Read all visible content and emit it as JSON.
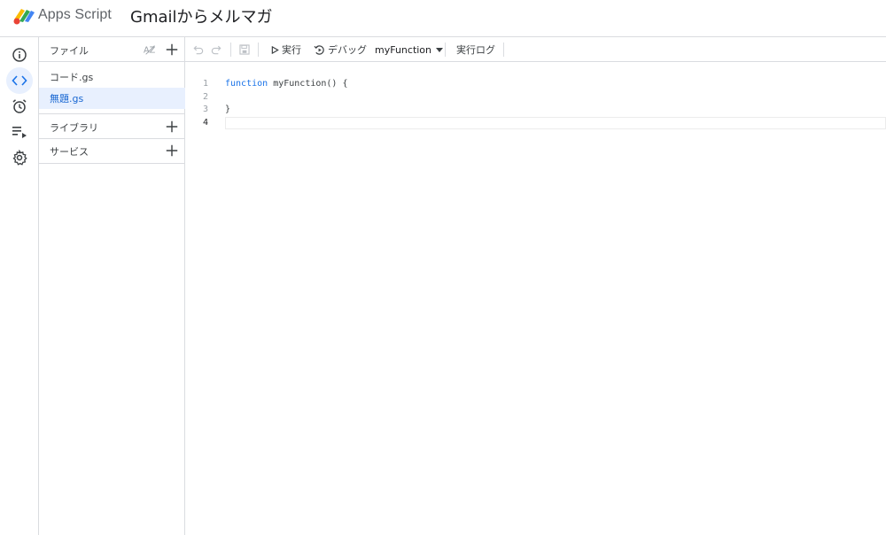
{
  "header": {
    "app_name": "Apps Script",
    "project_title": "Gmailからメルマガ"
  },
  "rail": {
    "items": [
      {
        "icon": "info-icon",
        "active": false
      },
      {
        "icon": "code-icon",
        "active": true
      },
      {
        "icon": "alarm-icon",
        "active": false
      },
      {
        "icon": "playlist-play-icon",
        "active": false
      },
      {
        "icon": "gear-icon",
        "active": false
      }
    ]
  },
  "files_panel": {
    "title": "ファイル",
    "files": [
      {
        "name": "コード.gs",
        "selected": false
      },
      {
        "name": "無題.gs",
        "selected": true
      }
    ],
    "libraries_label": "ライブラリ",
    "services_label": "サービス"
  },
  "toolbar": {
    "run_label": "実行",
    "debug_label": "デバッグ",
    "function_select": "myFunction",
    "log_label": "実行ログ"
  },
  "editor": {
    "current_line": 4,
    "lines": [
      {
        "num": "1",
        "keyword": "function",
        "text": " myFunction() {"
      },
      {
        "num": "2",
        "keyword": "",
        "text": ""
      },
      {
        "num": "3",
        "keyword": "",
        "text": "}"
      },
      {
        "num": "4",
        "keyword": "",
        "text": ""
      }
    ]
  },
  "colors": {
    "accent": "#1a73e8",
    "selected_bg": "#e8f0fe",
    "border": "#dadce0"
  }
}
